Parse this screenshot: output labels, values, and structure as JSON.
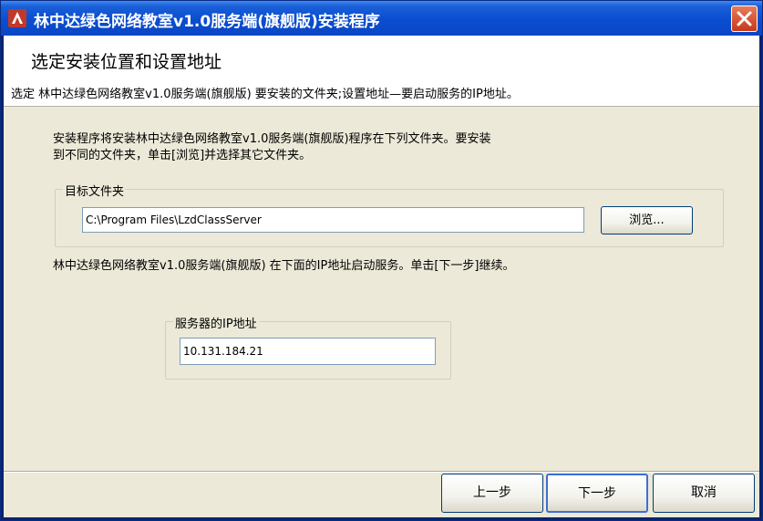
{
  "window": {
    "title": "林中达绿色网络教室v1.0服务端(旗舰版)安装程序"
  },
  "header": {
    "title": "选定安装位置和设置地址",
    "subtitle": "选定 林中达绿色网络教室v1.0服务端(旗舰版) 要安装的文件夹;设置地址—要启动服务的IP地址。"
  },
  "body": {
    "info_line1": "安装程序将安装林中达绿色网络教室v1.0服务端(旗舰版)程序在下列文件夹。要安装",
    "info_line2": "到不同的文件夹，单击[浏览]并选择其它文件夹。",
    "folder_group_label": "目标文件夹",
    "folder_path": "C:\\Program Files\\LzdClassServer",
    "browse_label": "浏览...",
    "ip_info": "林中达绿色网络教室v1.0服务端(旗舰版) 在下面的IP地址启动服务。单击[下一步]继续。",
    "ip_group_label": "服务器的IP地址",
    "ip_value": "10.131.184.21"
  },
  "footer": {
    "back_label": "上一步",
    "next_label": "下一步",
    "cancel_label": "取消"
  },
  "colors": {
    "titlebar": "#0a4dd0",
    "face": "#ece9d8",
    "close": "#c6381a"
  },
  "icons": {
    "app": "app-logo-icon",
    "close": "close-icon"
  }
}
